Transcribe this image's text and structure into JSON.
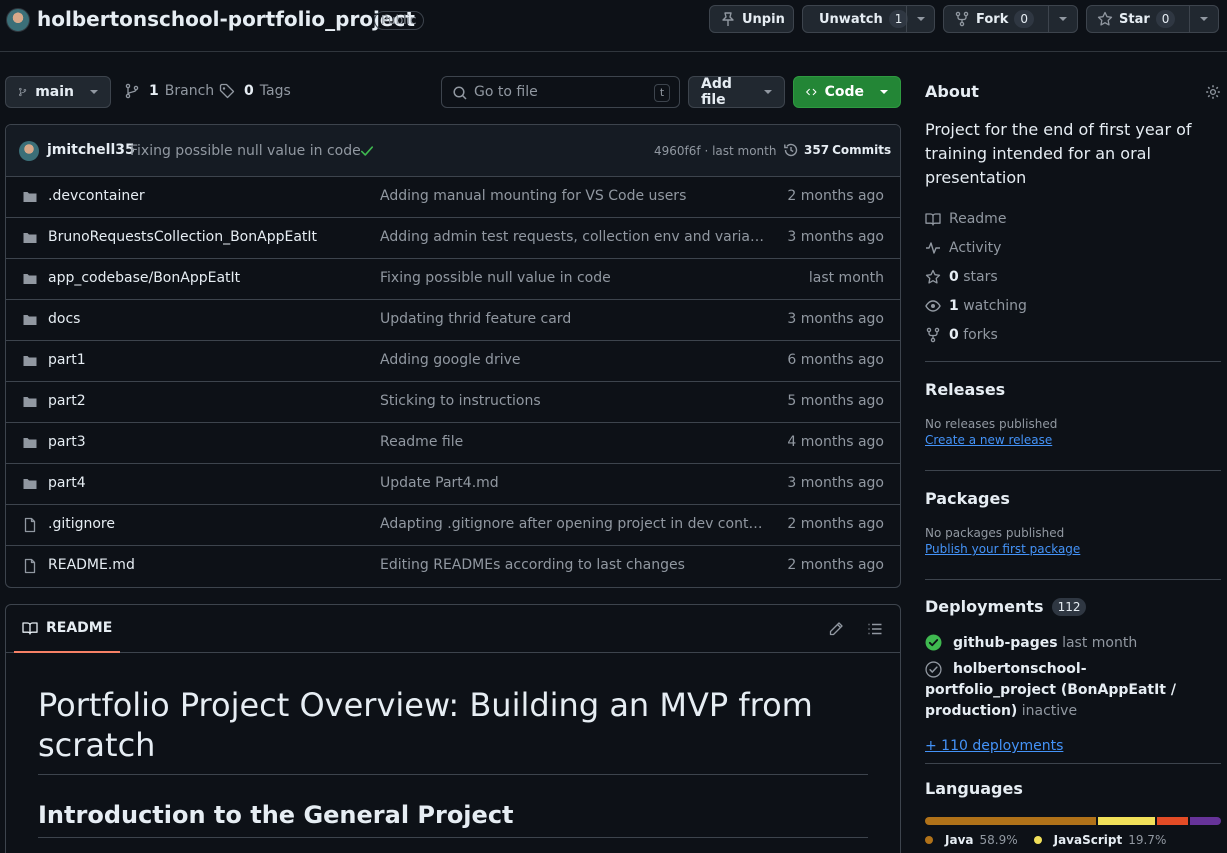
{
  "repo": {
    "name": "holbertonschool-portfolio_project",
    "visibility": "Public"
  },
  "header_actions": {
    "unpin_label": "Unpin",
    "unwatch_label": "Unwatch",
    "watch_count": "1",
    "fork_label": "Fork",
    "fork_count": "0",
    "star_label": "Star",
    "star_count": "0"
  },
  "toolbar": {
    "branch": "main",
    "branches_count": "1",
    "branches_label": "Branch",
    "tags_count": "0",
    "tags_label": "Tags",
    "search_placeholder": "Go to file",
    "search_shortcut": "t",
    "add_file_label": "Add file",
    "code_label": "Code"
  },
  "latest_commit": {
    "author": "jmitchell35",
    "message": "Fixing possible null value in code",
    "sha_time": "4960f6f · last month",
    "commits_count": "357",
    "commits_label": "Commits"
  },
  "files": [
    {
      "type": "dir",
      "name": ".devcontainer",
      "message": "Adding manual mounting for VS Code users",
      "date": "2 months ago"
    },
    {
      "type": "dir",
      "name": "BrunoRequestsCollection_BonAppEatIt",
      "message": "Adding admin test requests, collection env and variables for fur…",
      "date": "3 months ago"
    },
    {
      "type": "dir",
      "name": "app_codebase/BonAppEatIt",
      "message": "Fixing possible null value in code",
      "date": "last month"
    },
    {
      "type": "dir",
      "name": "docs",
      "message": "Updating thrid feature card",
      "date": "3 months ago"
    },
    {
      "type": "dir",
      "name": "part1",
      "message": "Adding google drive",
      "date": "6 months ago"
    },
    {
      "type": "dir",
      "name": "part2",
      "message": "Sticking to instructions",
      "date": "5 months ago"
    },
    {
      "type": "dir",
      "name": "part3",
      "message": "Readme file",
      "date": "4 months ago"
    },
    {
      "type": "dir",
      "name": "part4",
      "message": "Update Part4.md",
      "date": "3 months ago"
    },
    {
      "type": "file",
      "name": ".gitignore",
      "message": "Adapting .gitignore after opening project in dev container…",
      "date": "2 months ago"
    },
    {
      "type": "file",
      "name": "README.md",
      "message": "Editing READMEs according to last changes",
      "date": "2 months ago"
    }
  ],
  "readme": {
    "tab_label": "README",
    "h1": "Portfolio Project Overview: Building an MVP from scratch",
    "h2": "Introduction to the General Project"
  },
  "about": {
    "title": "About",
    "description": "Project for the end of first year of training intended for an oral presentation",
    "links": {
      "readme": "Readme",
      "activity": "Activity",
      "stars_count": "0",
      "stars_label": "stars",
      "watching_count": "1",
      "watching_label": "watching",
      "forks_count": "0",
      "forks_label": "forks"
    }
  },
  "releases": {
    "title": "Releases",
    "empty": "No releases published",
    "link": "Create a new release"
  },
  "packages": {
    "title": "Packages",
    "empty": "No packages published",
    "link": "Publish your first package"
  },
  "deployments": {
    "title": "Deployments",
    "count": "112",
    "items": [
      {
        "name": "github-pages",
        "status": "last month"
      },
      {
        "name": "holbertonschool-portfolio_project (BonAppEatIt / production)",
        "status": "inactive"
      }
    ],
    "more_link": "+ 110 deployments"
  },
  "languages": {
    "title": "Languages",
    "items": [
      {
        "name": "Java",
        "percent": "58.9%",
        "value": 58.9,
        "color": "#b07219"
      },
      {
        "name": "JavaScript",
        "percent": "19.7%",
        "value": 19.7,
        "color": "#f1e05a"
      },
      {
        "name": "",
        "percent": "",
        "value": 10.6,
        "color": "#e34c26"
      },
      {
        "name": "",
        "percent": "",
        "value": 10.6,
        "color": "#663399"
      }
    ]
  },
  "colors": {
    "background": "#0d1117",
    "border": "#3d444d",
    "accent_green": "#238636",
    "link_blue": "#4493f8",
    "success": "#3fb950"
  }
}
